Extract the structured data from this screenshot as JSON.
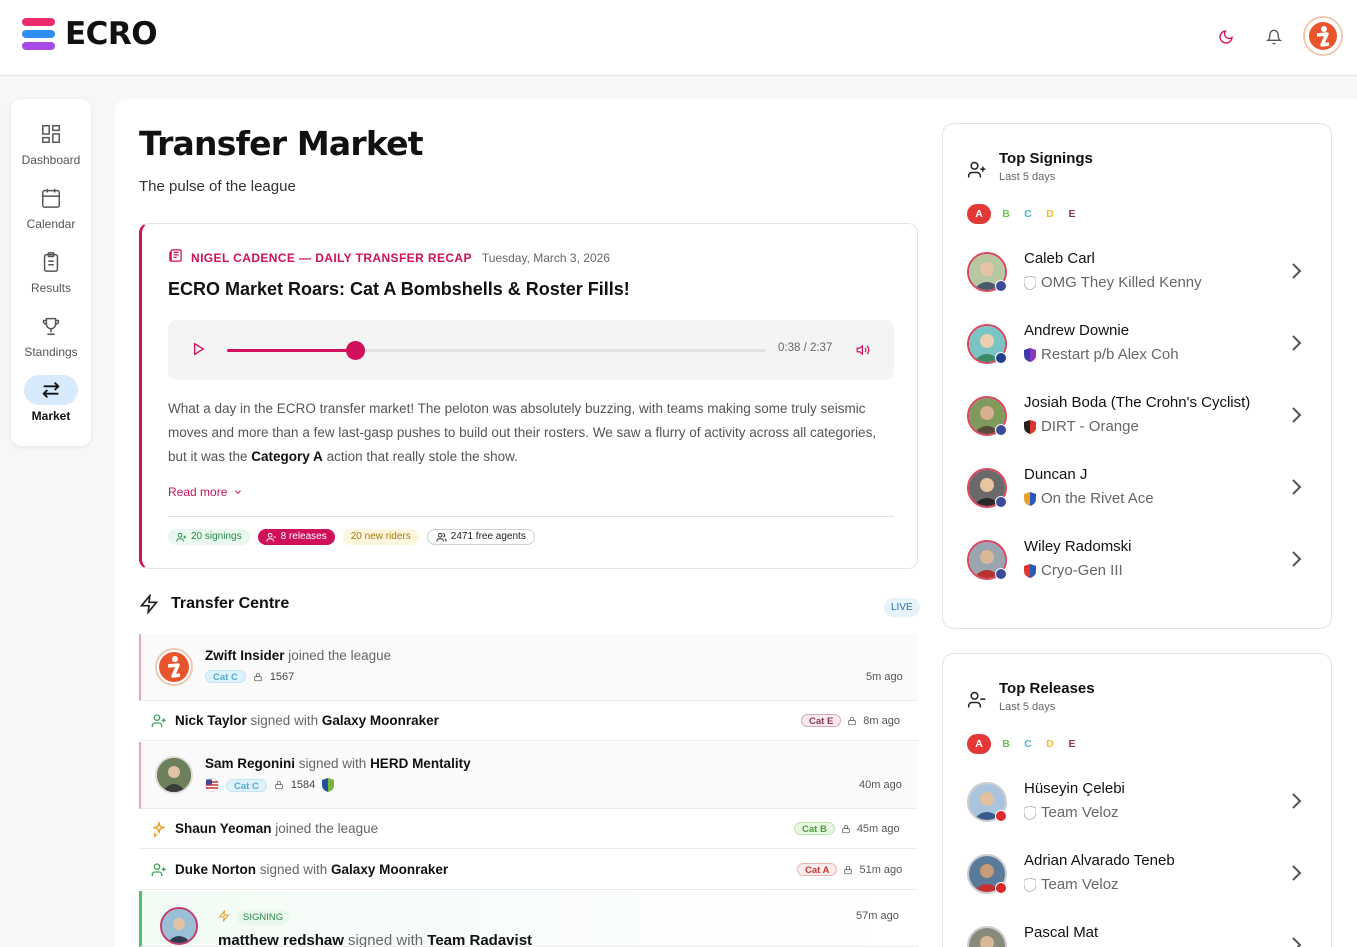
{
  "app": {
    "logo_text": "ECRO"
  },
  "sidebar": {
    "items": [
      {
        "label": "Dashboard",
        "icon": "dashboard-icon"
      },
      {
        "label": "Calendar",
        "icon": "calendar-icon"
      },
      {
        "label": "Results",
        "icon": "clipboard-icon"
      },
      {
        "label": "Standings",
        "icon": "trophy-icon"
      },
      {
        "label": "Market",
        "icon": "swap-icon",
        "active": true
      }
    ]
  },
  "page": {
    "title": "Transfer Market",
    "subtitle": "The pulse of the league"
  },
  "recap": {
    "author": "NIGEL CADENCE — DAILY TRANSFER RECAP",
    "date": "Tuesday, March 3, 2026",
    "title": "ECRO Market Roars: Cat A Bombshells & Roster Fills!",
    "audio_time": "0:38 / 2:37",
    "audio_progress": 0.24,
    "body_1": "What a day in the ECRO transfer market! The peloton was absolutely buzzing, with teams making some truly seismic moves and more than a few last-gasp pushes to build out their rosters. We saw a flurry of activity across all categories, but it was the ",
    "body_bold": "Category A",
    "body_2": " action that really stole the show.",
    "read_more": "Read more",
    "chips": {
      "signings": "20 signings",
      "releases": "8 releases",
      "new_riders": "20 new riders",
      "free_agents": "2471 free agents"
    }
  },
  "transfer_centre": {
    "title": "Transfer Centre",
    "live": "LIVE",
    "feed": [
      {
        "name": "Zwift Insider",
        "action": " joined the league",
        "cat": "Cat C",
        "score": "1567",
        "ago": "5m ago"
      },
      {
        "name": "Nick Taylor",
        "action": " signed with ",
        "team": "Galaxy Moonraker",
        "cat": "Cat E",
        "ago": "8m ago"
      },
      {
        "name": "Sam Regonini",
        "action": " signed with ",
        "team": "HERD Mentality",
        "cat": "Cat C",
        "score": "1584",
        "ago": "40m ago"
      },
      {
        "name": "Shaun Yeoman",
        "action": " joined the league",
        "cat": "Cat B",
        "ago": "45m ago"
      },
      {
        "name": "Duke Norton",
        "action": " signed with ",
        "team": "Galaxy Moonraker",
        "cat": "Cat A",
        "ago": "51m ago"
      },
      {
        "badge": "SIGNING",
        "name": "matthew redshaw",
        "action": " signed with ",
        "team": "Team Radavist",
        "ago": "57m ago"
      }
    ]
  },
  "top_signings": {
    "title": "Top Signings",
    "subtitle": "Last 5 days",
    "tabs": [
      "A",
      "B",
      "C",
      "D",
      "E"
    ],
    "riders": [
      {
        "name": "Caleb Carl",
        "team": "OMG They Killed Kenny"
      },
      {
        "name": "Andrew Downie",
        "team": "Restart p/b Alex Coh"
      },
      {
        "name": "Josiah Boda (The Crohn's Cyclist)",
        "team": "DIRT - Orange"
      },
      {
        "name": "Duncan J",
        "team": "On the Rivet Ace"
      },
      {
        "name": "Wiley Radomski",
        "team": "Cryo-Gen III"
      }
    ]
  },
  "top_releases": {
    "title": "Top Releases",
    "subtitle": "Last 5 days",
    "tabs": [
      "A",
      "B",
      "C",
      "D",
      "E"
    ],
    "riders": [
      {
        "name": "Hüseyin Çelebi",
        "team": "Team Veloz"
      },
      {
        "name": "Adrian Alvarado Teneb",
        "team": "Team Veloz"
      },
      {
        "name": "Pascal Mat",
        "team": ""
      }
    ]
  },
  "colors": {
    "accent": "#d0105b",
    "active_tab": "#e43838",
    "live_bg": "#e7f3fb"
  }
}
